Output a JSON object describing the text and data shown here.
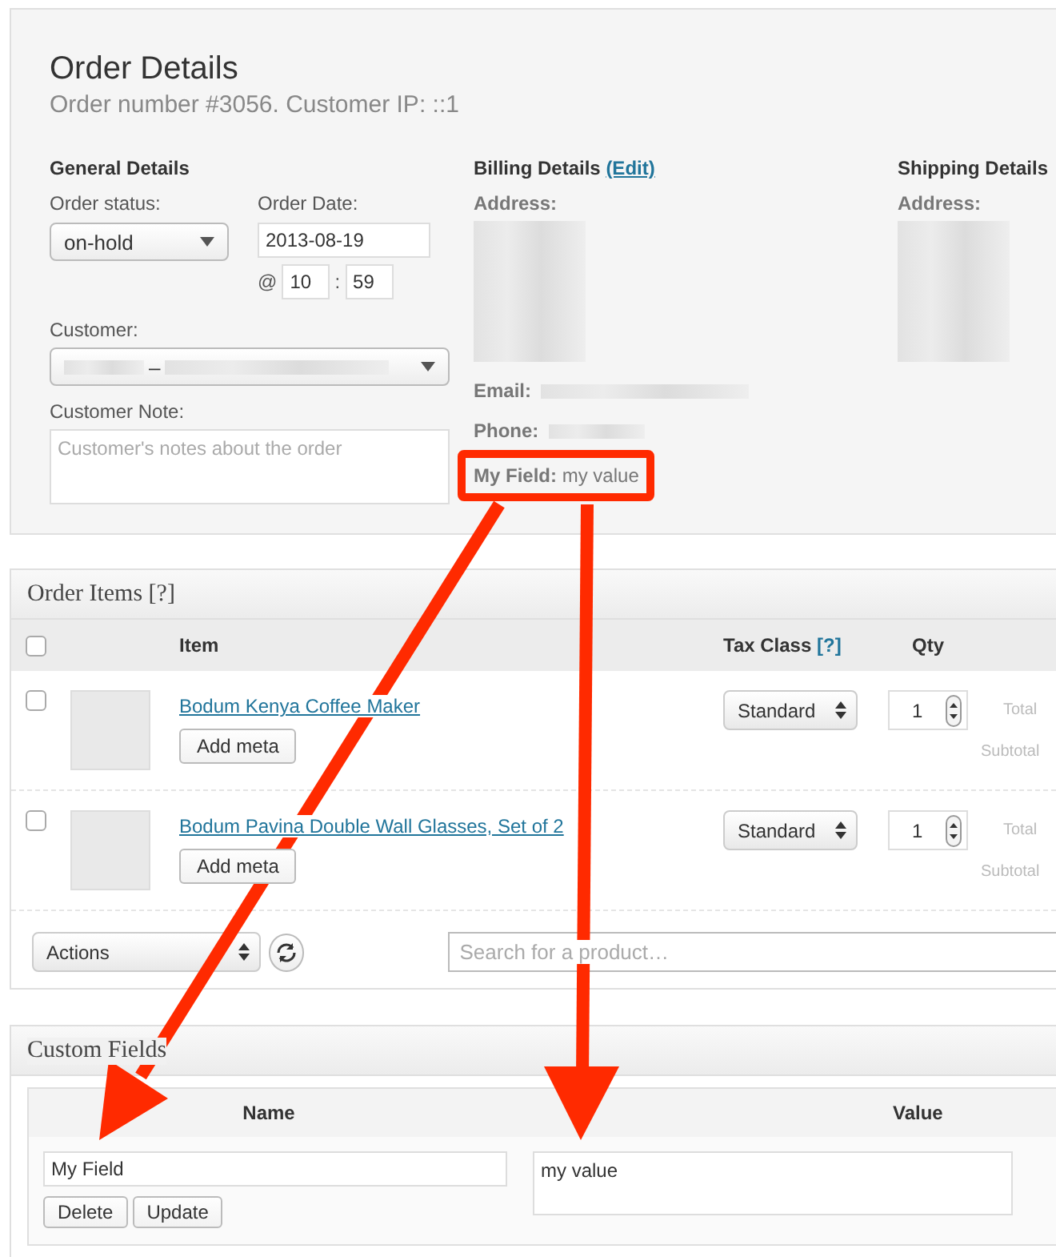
{
  "order_details": {
    "title": "Order Details",
    "subtitle": "Order number #3056. Customer IP: ::1",
    "general": {
      "heading": "General Details",
      "status_label": "Order status:",
      "status_value": "on-hold",
      "date_label": "Order Date:",
      "date_value": "2013-08-19",
      "at": "@",
      "hour": "10",
      "colon": ":",
      "minute": "59",
      "customer_label": "Customer:",
      "customer_dash": "–",
      "note_label": "Customer Note:",
      "note_placeholder": "Customer's notes about the order"
    },
    "billing": {
      "heading": "Billing Details",
      "edit_link": "(Edit)",
      "address_label": "Address:",
      "email_label": "Email:",
      "phone_label": "Phone:",
      "custom_field": {
        "label": "My Field:",
        "value": "my value",
        "highlighted": true
      }
    },
    "shipping": {
      "heading": "Shipping Details",
      "address_label": "Address:"
    }
  },
  "order_items": {
    "title": "Order Items [?]",
    "header_checked": false,
    "columns": {
      "item": "Item",
      "tax_class": "Tax Class",
      "tax_help": "[?]",
      "qty": "Qty"
    },
    "rows": [
      {
        "checked": false,
        "name": "Bodum Kenya Coffee Maker",
        "button": "Add meta",
        "tax_class": "Standard",
        "qty": "1",
        "total_label": "Total",
        "subtotal_label": "Subtotal"
      },
      {
        "checked": false,
        "name": "Bodum Pavina Double Wall Glasses, Set of 2",
        "button": "Add meta",
        "tax_class": "Standard",
        "qty": "1",
        "total_label": "Total",
        "subtotal_label": "Subtotal"
      }
    ],
    "actions": "Actions",
    "search_placeholder": "Search for a product…"
  },
  "custom_fields": {
    "title": "Custom Fields",
    "columns": [
      "Name",
      "Value"
    ],
    "rows": [
      {
        "name": "My Field",
        "value": "my value",
        "buttons": [
          "Delete",
          "Update"
        ]
      }
    ]
  }
}
